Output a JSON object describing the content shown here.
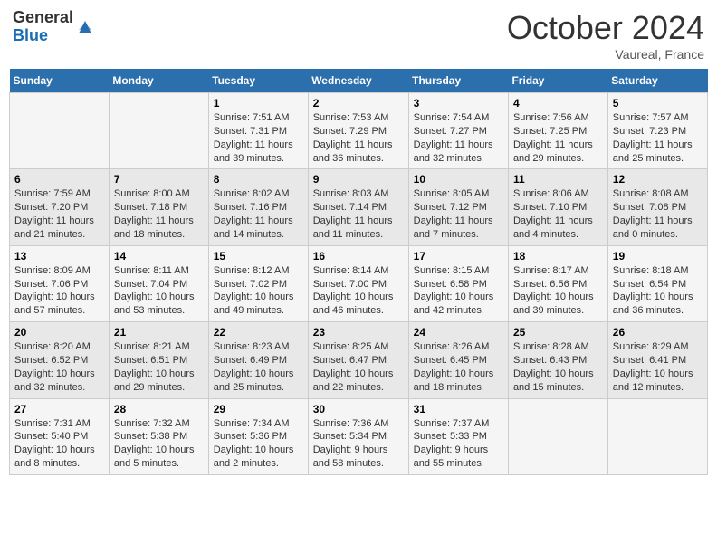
{
  "header": {
    "logo_general": "General",
    "logo_blue": "Blue",
    "month": "October 2024",
    "location": "Vaureal, France"
  },
  "weekdays": [
    "Sunday",
    "Monday",
    "Tuesday",
    "Wednesday",
    "Thursday",
    "Friday",
    "Saturday"
  ],
  "weeks": [
    [
      {
        "day": "",
        "info": ""
      },
      {
        "day": "",
        "info": ""
      },
      {
        "day": "1",
        "info": "Sunrise: 7:51 AM\nSunset: 7:31 PM\nDaylight: 11 hours and 39 minutes."
      },
      {
        "day": "2",
        "info": "Sunrise: 7:53 AM\nSunset: 7:29 PM\nDaylight: 11 hours and 36 minutes."
      },
      {
        "day": "3",
        "info": "Sunrise: 7:54 AM\nSunset: 7:27 PM\nDaylight: 11 hours and 32 minutes."
      },
      {
        "day": "4",
        "info": "Sunrise: 7:56 AM\nSunset: 7:25 PM\nDaylight: 11 hours and 29 minutes."
      },
      {
        "day": "5",
        "info": "Sunrise: 7:57 AM\nSunset: 7:23 PM\nDaylight: 11 hours and 25 minutes."
      }
    ],
    [
      {
        "day": "6",
        "info": "Sunrise: 7:59 AM\nSunset: 7:20 PM\nDaylight: 11 hours and 21 minutes."
      },
      {
        "day": "7",
        "info": "Sunrise: 8:00 AM\nSunset: 7:18 PM\nDaylight: 11 hours and 18 minutes."
      },
      {
        "day": "8",
        "info": "Sunrise: 8:02 AM\nSunset: 7:16 PM\nDaylight: 11 hours and 14 minutes."
      },
      {
        "day": "9",
        "info": "Sunrise: 8:03 AM\nSunset: 7:14 PM\nDaylight: 11 hours and 11 minutes."
      },
      {
        "day": "10",
        "info": "Sunrise: 8:05 AM\nSunset: 7:12 PM\nDaylight: 11 hours and 7 minutes."
      },
      {
        "day": "11",
        "info": "Sunrise: 8:06 AM\nSunset: 7:10 PM\nDaylight: 11 hours and 4 minutes."
      },
      {
        "day": "12",
        "info": "Sunrise: 8:08 AM\nSunset: 7:08 PM\nDaylight: 11 hours and 0 minutes."
      }
    ],
    [
      {
        "day": "13",
        "info": "Sunrise: 8:09 AM\nSunset: 7:06 PM\nDaylight: 10 hours and 57 minutes."
      },
      {
        "day": "14",
        "info": "Sunrise: 8:11 AM\nSunset: 7:04 PM\nDaylight: 10 hours and 53 minutes."
      },
      {
        "day": "15",
        "info": "Sunrise: 8:12 AM\nSunset: 7:02 PM\nDaylight: 10 hours and 49 minutes."
      },
      {
        "day": "16",
        "info": "Sunrise: 8:14 AM\nSunset: 7:00 PM\nDaylight: 10 hours and 46 minutes."
      },
      {
        "day": "17",
        "info": "Sunrise: 8:15 AM\nSunset: 6:58 PM\nDaylight: 10 hours and 42 minutes."
      },
      {
        "day": "18",
        "info": "Sunrise: 8:17 AM\nSunset: 6:56 PM\nDaylight: 10 hours and 39 minutes."
      },
      {
        "day": "19",
        "info": "Sunrise: 8:18 AM\nSunset: 6:54 PM\nDaylight: 10 hours and 36 minutes."
      }
    ],
    [
      {
        "day": "20",
        "info": "Sunrise: 8:20 AM\nSunset: 6:52 PM\nDaylight: 10 hours and 32 minutes."
      },
      {
        "day": "21",
        "info": "Sunrise: 8:21 AM\nSunset: 6:51 PM\nDaylight: 10 hours and 29 minutes."
      },
      {
        "day": "22",
        "info": "Sunrise: 8:23 AM\nSunset: 6:49 PM\nDaylight: 10 hours and 25 minutes."
      },
      {
        "day": "23",
        "info": "Sunrise: 8:25 AM\nSunset: 6:47 PM\nDaylight: 10 hours and 22 minutes."
      },
      {
        "day": "24",
        "info": "Sunrise: 8:26 AM\nSunset: 6:45 PM\nDaylight: 10 hours and 18 minutes."
      },
      {
        "day": "25",
        "info": "Sunrise: 8:28 AM\nSunset: 6:43 PM\nDaylight: 10 hours and 15 minutes."
      },
      {
        "day": "26",
        "info": "Sunrise: 8:29 AM\nSunset: 6:41 PM\nDaylight: 10 hours and 12 minutes."
      }
    ],
    [
      {
        "day": "27",
        "info": "Sunrise: 7:31 AM\nSunset: 5:40 PM\nDaylight: 10 hours and 8 minutes."
      },
      {
        "day": "28",
        "info": "Sunrise: 7:32 AM\nSunset: 5:38 PM\nDaylight: 10 hours and 5 minutes."
      },
      {
        "day": "29",
        "info": "Sunrise: 7:34 AM\nSunset: 5:36 PM\nDaylight: 10 hours and 2 minutes."
      },
      {
        "day": "30",
        "info": "Sunrise: 7:36 AM\nSunset: 5:34 PM\nDaylight: 9 hours and 58 minutes."
      },
      {
        "day": "31",
        "info": "Sunrise: 7:37 AM\nSunset: 5:33 PM\nDaylight: 9 hours and 55 minutes."
      },
      {
        "day": "",
        "info": ""
      },
      {
        "day": "",
        "info": ""
      }
    ]
  ]
}
